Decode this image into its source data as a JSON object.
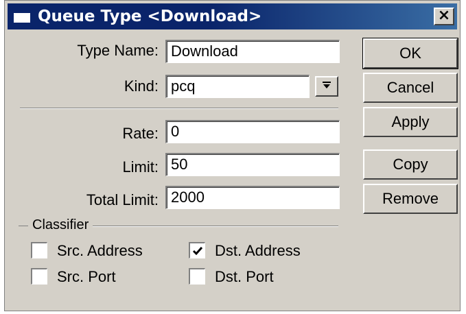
{
  "window": {
    "title": "Queue Type <Download>",
    "close_glyph": "×"
  },
  "form": {
    "type_name": {
      "label": "Type Name:",
      "value": "Download"
    },
    "kind": {
      "label": "Kind:",
      "value": "pcq",
      "dropdown_icon": "dropdown-arrow-icon"
    },
    "rate": {
      "label": "Rate:",
      "value": "0"
    },
    "limit": {
      "label": "Limit:",
      "value": "50"
    },
    "total_limit": {
      "label": "Total Limit:",
      "value": "2000"
    }
  },
  "classifier": {
    "label": "Classifier",
    "src_address": {
      "label": "Src. Address",
      "checked": false
    },
    "dst_address": {
      "label": "Dst. Address",
      "checked": true
    },
    "src_port": {
      "label": "Src. Port",
      "checked": false
    },
    "dst_port": {
      "label": "Dst. Port",
      "checked": false
    }
  },
  "buttons": {
    "ok": "OK",
    "cancel": "Cancel",
    "apply": "Apply",
    "copy": "Copy",
    "remove": "Remove"
  },
  "colors": {
    "titlebar": "#0a246a",
    "window_bg": "#d4d0c8"
  }
}
